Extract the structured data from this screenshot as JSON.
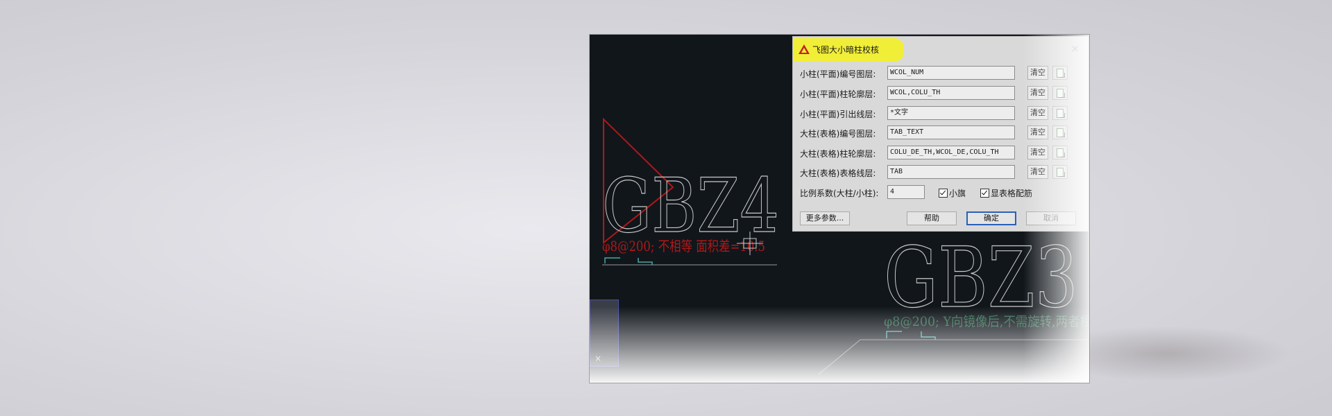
{
  "dialog": {
    "title": "飞图大小暗柱校核",
    "close_glyph": "×",
    "rows": [
      {
        "label": "小柱(平面)编号图层:",
        "value": "WCOL_NUM",
        "clear": "清空"
      },
      {
        "label": "小柱(平面)柱轮廓层:",
        "value": "WCOL,COLU_TH",
        "clear": "清空"
      },
      {
        "label": "小柱(平面)引出线层:",
        "value": "*文字",
        "clear": "清空"
      },
      {
        "label": "大柱(表格)编号图层:",
        "value": "TAB_TEXT",
        "clear": "清空"
      },
      {
        "label": "大柱(表格)柱轮廓层:",
        "value": "COLU_DE_TH,WCOL_DE,COLU_TH",
        "clear": "清空"
      },
      {
        "label": "大柱(表格)表格线层:",
        "value": "TAB",
        "clear": "清空"
      }
    ],
    "ratio": {
      "label": "比例系数(大柱/小柱):",
      "value": "4"
    },
    "checkboxes": [
      {
        "label": "小旗",
        "checked": true
      },
      {
        "label": "显表格配筋",
        "checked": true
      }
    ],
    "buttons": {
      "more": "更多参数...",
      "help": "帮助",
      "ok": "确定",
      "cancel": "取消"
    }
  },
  "cad": {
    "label_left": "GBZ4",
    "label_right": "GBZ3",
    "note_left": "φ8@200; 不相等 面积差=10.5",
    "note_right": "φ8@200; Y向镜像后,不需旋转,两者相",
    "colors": {
      "background": "#11161b",
      "outline": "#c8c8c8",
      "error_red": "#b01818",
      "note_green": "#2f6a4f",
      "accent_cyan": "#4aa7a7"
    }
  }
}
